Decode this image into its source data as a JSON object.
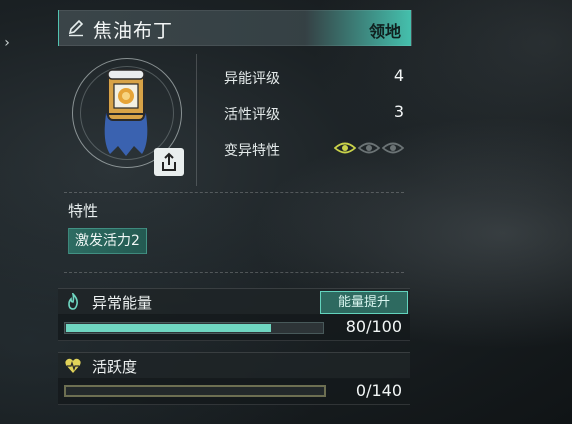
{
  "header": {
    "title": "焦油布丁",
    "tag": "领地",
    "edit_icon": "pencil-icon"
  },
  "stats": [
    {
      "label": "异能评级",
      "value": "4"
    },
    {
      "label": "活性评级",
      "value": "3"
    },
    {
      "label": "变异特性"
    }
  ],
  "mutation_eyes": {
    "active": 1,
    "total": 3,
    "active_color": "#c9d24a",
    "inactive_color": "#6b7375"
  },
  "share_icon": "share-icon",
  "traits": {
    "label": "特性",
    "items": [
      "激发活力2"
    ]
  },
  "energy": {
    "label": "异常能量",
    "button": "能量提升",
    "value_text": "80/100",
    "current": 80,
    "max": 100,
    "icon": "flame-icon",
    "fill_color": "#6fd6c1"
  },
  "activity": {
    "label": "活跃度",
    "value_text": "0/140",
    "current": 0,
    "max": 140,
    "icon": "heartbeat-icon"
  }
}
